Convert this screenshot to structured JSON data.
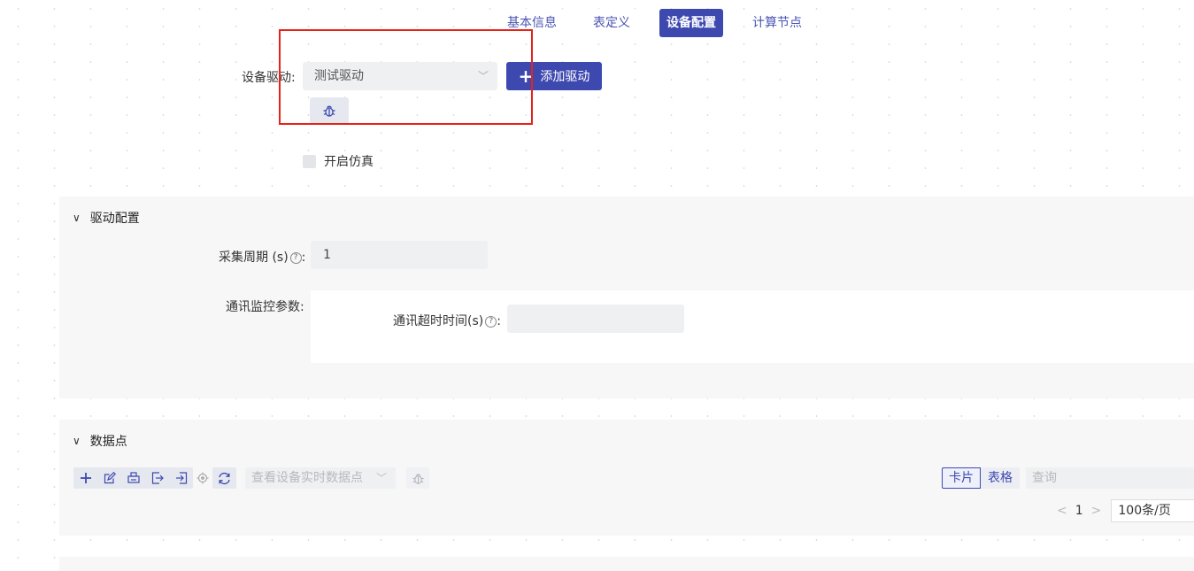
{
  "tabs": [
    {
      "label": "基本信息",
      "active": false
    },
    {
      "label": "表定义",
      "active": false
    },
    {
      "label": "设备配置",
      "active": true
    },
    {
      "label": "计算节点",
      "active": false
    }
  ],
  "driver": {
    "label": "设备驱动:",
    "selected": "测试驱动",
    "add_button": "添加驱动"
  },
  "simulation": {
    "label": "开启仿真",
    "checked": false
  },
  "driver_config": {
    "title": "驱动配置",
    "period_label": "采集周期 (s)",
    "period_colon": ":",
    "period_value": "1",
    "monitor_label": "通讯监控参数:",
    "timeout_label": "通讯超时时间(s)",
    "timeout_colon": ":",
    "timeout_value": ""
  },
  "data_points": {
    "title": "数据点",
    "realtime_select": "查看设备实时数据点",
    "view_card": "卡片",
    "view_table": "表格",
    "search_placeholder": "查询",
    "page": "1",
    "page_size": "100条/页"
  },
  "colors": {
    "primary": "#3e49b0",
    "highlight_box": "#e4231b"
  }
}
